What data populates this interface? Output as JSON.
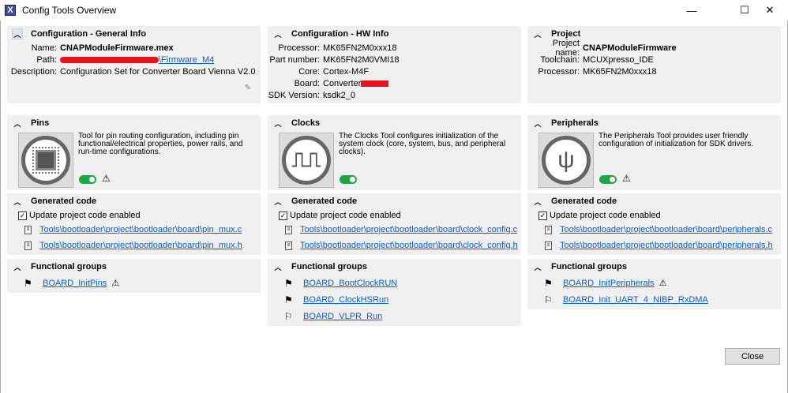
{
  "window": {
    "title": "Config Tools Overview",
    "minimize": "—",
    "maximize": "☐",
    "close": "✕"
  },
  "general": {
    "title": "Configuration - General Info",
    "name_label": "Name:",
    "name": "CNAPModuleFirmware.mex",
    "path_label": "Path:",
    "path": "\\Firmware_M4",
    "desc_label": "Description:",
    "desc": "Configuration Set for Converter Board Vienna V2.0"
  },
  "hw": {
    "title": "Configuration - HW Info",
    "rows": [
      {
        "k": "Processor:",
        "v": "MK65FN2M0xxx18"
      },
      {
        "k": "Part number:",
        "v": "MK65FN2M0VMI18"
      },
      {
        "k": "Core:",
        "v": "Cortex-M4F"
      },
      {
        "k": "Board:",
        "v": "Converter"
      },
      {
        "k": "SDK Version:",
        "v": "ksdk2_0"
      }
    ]
  },
  "project": {
    "title": "Project",
    "rows": [
      {
        "k": "Project name:",
        "v": "CNAPModuleFirmware"
      },
      {
        "k": "Toolchain:",
        "v": "MCUXpresso_IDE"
      },
      {
        "k": "Processor:",
        "v": "MK65FN2M0xxx18"
      }
    ]
  },
  "tools": [
    {
      "title": "Pins",
      "desc": "Tool for pin routing configuration, including pin functional/electrical properties, power rails, and run-time configurations.",
      "enabled": true,
      "files": [
        "Tools\\bootloader\\project\\bootloader\\board\\pin_mux.c",
        "Tools\\bootloader\\project\\bootloader\\board\\pin_mux.h"
      ],
      "groups": [
        "BOARD_InitPins"
      ]
    },
    {
      "title": "Clocks",
      "desc": "The Clocks Tool configures initialization of the system clock (core, system, bus, and peripheral clocks).",
      "enabled": true,
      "files": [
        "Tools\\bootloader\\project\\bootloader\\board\\clock_config.c",
        "Tools\\bootloader\\project\\bootloader\\board\\clock_config.h"
      ],
      "groups": [
        "BOARD_BootClockRUN",
        "BOARD_ClockHSRun",
        "BOARD_VLPR_Run"
      ]
    },
    {
      "title": "Peripherals",
      "desc": "The Peripherals Tool provides user friendly configuration of initialization for SDK drivers.",
      "enabled": true,
      "files": [
        "Tools\\bootloader\\project\\bootloader\\board\\peripherals.c",
        "Tools\\bootloader\\project\\bootloader\\board\\peripherals.h"
      ],
      "groups": [
        "BOARD_InitPeripherals",
        "BOARD_Init_UART_4_NIBP_RxDMA"
      ]
    }
  ],
  "generated_code_title": "Generated code",
  "update_label": "Update project code enabled",
  "functional_groups_title": "Functional groups",
  "close_label": "Close",
  "accent": "#20a544",
  "link_color": "#0b5fc6",
  "redaction": "#e8141c"
}
